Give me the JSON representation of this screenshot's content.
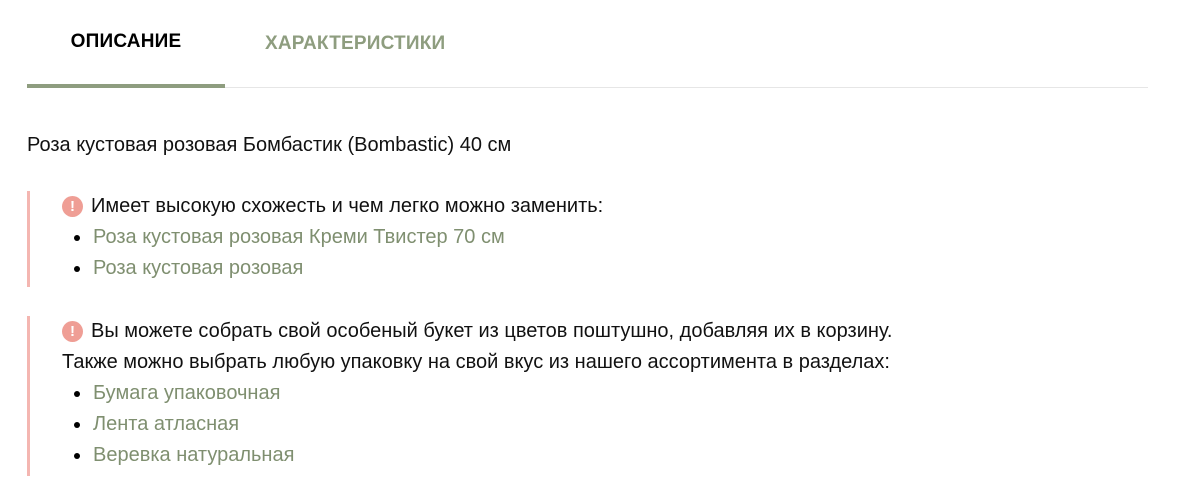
{
  "tabs": [
    {
      "label": "ОПИСАНИЕ",
      "active": true
    },
    {
      "label": "ХАРАКТЕРИСТИКИ",
      "active": false
    }
  ],
  "product": {
    "title": "Роза кустовая розовая Бомбастик (Bombastic) 40 см"
  },
  "note_similar": {
    "icon": "exclamation-circle-icon",
    "text": "Имеет высокую схожесть и чем легко можно заменить:",
    "links": [
      "Роза кустовая розовая Креми Твистер 70 см",
      "Роза кустовая розовая"
    ]
  },
  "note_bouquet": {
    "icon": "exclamation-circle-icon",
    "text": "Вы можете собрать свой особеный букет из цветов поштушно, добавляя их в корзину.",
    "text2": "Также можно выбрать любую упаковку на свой вкус из нашего ассортимента в разделах:",
    "links": [
      "Бумага упаковочная",
      "Лента атласная",
      "Веревка натуральная"
    ]
  },
  "colors": {
    "accent": "#8e9d7f",
    "link": "#7f8f70",
    "note_border": "#f4b6b1",
    "alert_icon": "#ef9e95"
  }
}
